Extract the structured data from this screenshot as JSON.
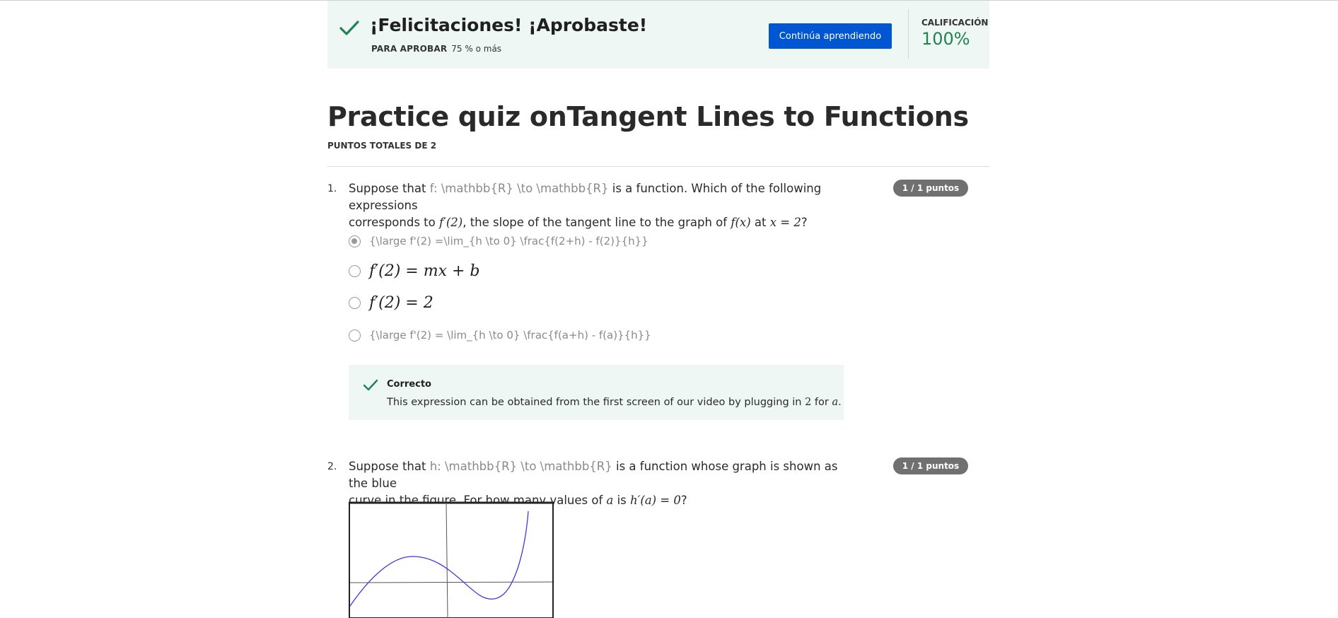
{
  "banner": {
    "title": "¡Felicitaciones! ¡Aprobaste!",
    "pass_label": "PARA APROBAR",
    "pass_value": "75 % o más",
    "continue_button": "Continúa aprendiendo",
    "grade_label": "CALIFICACIÓN",
    "grade_value": "100%",
    "check_icon": "checkmark-icon",
    "accent_color": "#1f8354",
    "button_color": "#0056d2"
  },
  "quiz": {
    "title": "Practice quiz onTangent Lines to Functions",
    "total_points": "PUNTOS TOTALES DE 2"
  },
  "questions": [
    {
      "number": "1.",
      "score": "1 / 1 puntos",
      "text_before": "Suppose that ",
      "raw_latex": "f: \\mathbb{R} \\to \\mathbb{R}",
      "text_mid": " is a function. Which of the following expressions",
      "line2_a": "corresponds to ",
      "math_fprime2": "f′(2)",
      "line2_b": ", the slope of the tangent line to the graph of ",
      "math_fx": "f(x)",
      "line2_c": " at ",
      "math_x2": "x = 2",
      "line2_d": "?",
      "options": [
        {
          "label": "{\\large f'(2) =\\lim_{h \\to 0} \\frac{f(2+h) - f(2)}{h}}",
          "selected": true,
          "style": "raw"
        },
        {
          "label": "f′(2) = mx + b",
          "selected": false,
          "style": "math"
        },
        {
          "label": "f′(2) = 2",
          "selected": false,
          "style": "math"
        },
        {
          "label": "{\\large f'(2) = \\lim_{h \\to 0} \\frac{f(a+h) - f(a)}{h}}",
          "selected": false,
          "style": "raw"
        }
      ],
      "feedback": {
        "heading": "Correcto",
        "body_a": "This expression can be obtained from the first screen of our video by plugging in ",
        "body_num": "2",
        "body_b": " for ",
        "body_var": "a",
        "body_c": "."
      }
    },
    {
      "number": "2.",
      "score": "1 / 1 puntos",
      "text_before": "Suppose that ",
      "raw_latex": "h: \\mathbb{R} \\to \\mathbb{R}",
      "text_mid": " is a function whose graph is shown as the blue",
      "line2_a": "curve in the figure. For how many values of ",
      "math_a": "a",
      "line2_b": " is ",
      "math_hprime": "h′(a) = 0",
      "line2_c": "?",
      "graph": {
        "curve_color": "#3b3bdc"
      }
    }
  ]
}
